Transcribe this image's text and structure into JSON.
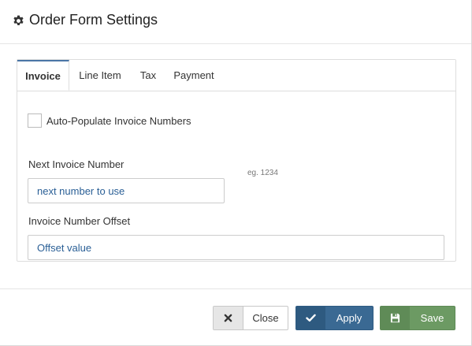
{
  "dialog": {
    "title": "Order Form Settings",
    "title_icon": "gear-icon"
  },
  "tabs": [
    {
      "label": "Invoice",
      "active": true
    },
    {
      "label": "Line Item",
      "active": false
    },
    {
      "label": "Tax",
      "active": false
    },
    {
      "label": "Payment",
      "active": false
    }
  ],
  "invoice": {
    "auto_populate_label": "Auto-Populate Invoice Numbers",
    "auto_populate_checked": false,
    "next_number_label": "Next Invoice Number",
    "next_number_placeholder": "next number to use",
    "next_number_value": "",
    "next_number_hint": "eg. 1234",
    "offset_label": "Invoice Number Offset",
    "offset_placeholder": "Offset value",
    "offset_value": ""
  },
  "footer": {
    "close_label": "Close",
    "close_icon": "close-icon",
    "apply_label": "Apply",
    "apply_icon": "checkmark-icon",
    "save_label": "Save",
    "save_icon": "floppy-disk-icon"
  },
  "colors": {
    "accent": "#4b76a6",
    "apply_button": "#3a6993",
    "save_button": "#6c9a63",
    "placeholder_text": "#2a5f96"
  }
}
